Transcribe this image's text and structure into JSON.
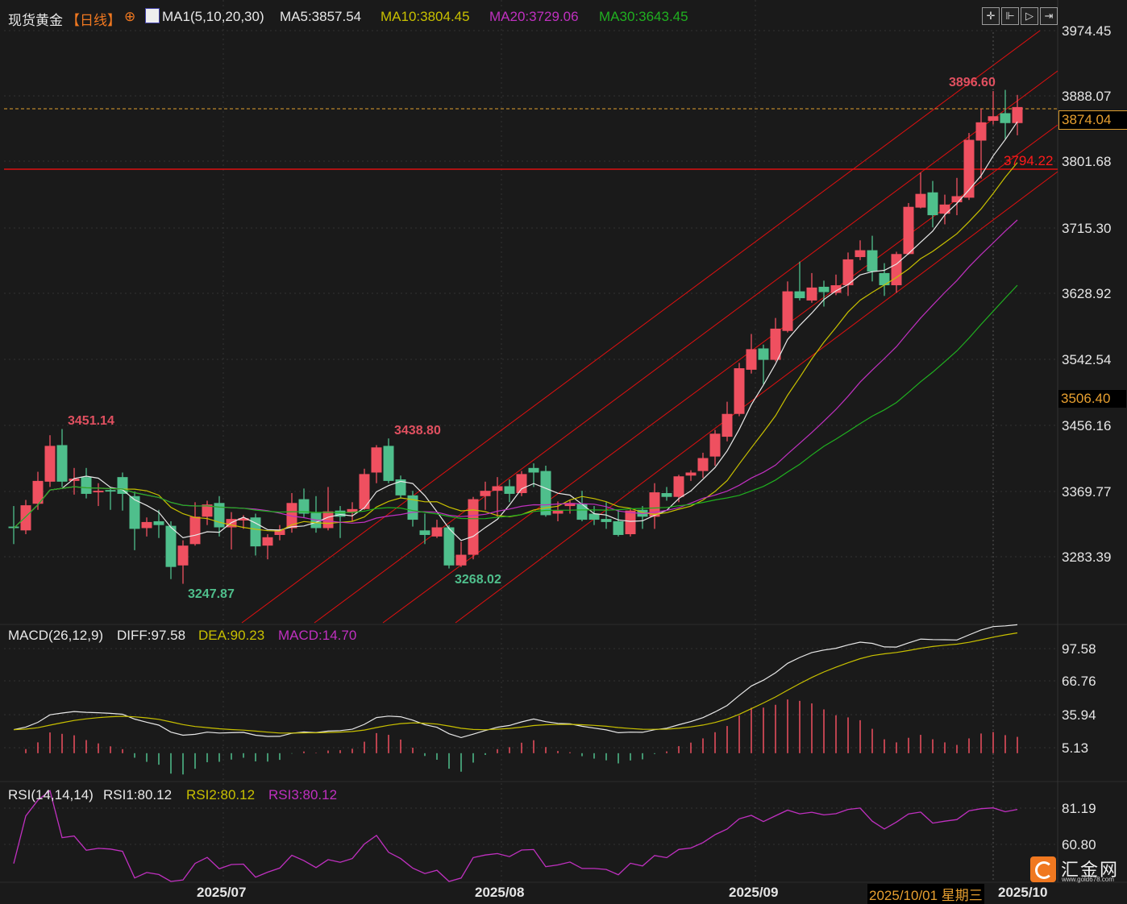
{
  "header": {
    "symbol": "现货黄金",
    "period": "【日线】",
    "ma_label": "MA1(5,10,20,30)",
    "ma5": "MA5:3857.54",
    "ma10": "MA10:3804.45",
    "ma20": "MA20:3729.06",
    "ma30": "MA30:3643.45"
  },
  "toolbar": {
    "icons": [
      "crosshair-icon",
      "range-icon",
      "play-icon",
      "scroll-right-icon"
    ]
  },
  "price_axis": {
    "ticks": [
      "3974.45",
      "3888.07",
      "3801.68",
      "3715.30",
      "3628.92",
      "3542.54",
      "3456.16",
      "3369.77",
      "3283.39"
    ],
    "current_price": "3874.04",
    "marker_price": "3506.40"
  },
  "annotations": {
    "high_recent": "3896.60",
    "high_july": "3451.14",
    "high_aug": "3438.80",
    "low_july": "3247.87",
    "low_aug": "3268.02",
    "hline": "3794.22"
  },
  "macd": {
    "label": "MACD(26,12,9)",
    "diff": "DIFF:97.58",
    "dea": "DEA:90.23",
    "macd": "MACD:14.70",
    "ticks": [
      "97.58",
      "66.76",
      "35.94",
      "5.13"
    ]
  },
  "rsi": {
    "label": "RSI(14,14,14)",
    "rsi1": "RSI1:80.12",
    "rsi2": "RSI2:80.12",
    "rsi3": "RSI3:80.12",
    "ticks": [
      "81.19",
      "60.80"
    ]
  },
  "dates": {
    "jul": "2025/07",
    "aug": "2025/08",
    "sep": "2025/09",
    "cursor": "2025/10/01 星期三",
    "oct": "2025/10"
  },
  "logo": {
    "name": "汇金网",
    "url": "www.gold678.com"
  },
  "colors": {
    "up": "#ef5060",
    "down": "#4fbf8c",
    "ma5": "#e8e8e8",
    "ma10": "#c8c000",
    "ma20": "#c030c0",
    "ma30": "#20b020",
    "channel": "#e01010"
  },
  "chart_data": {
    "type": "candlestick",
    "title": "现货黄金 日线",
    "ylim": [
      3283.39,
      3974.45
    ],
    "ohlc": [
      [
        3323,
        3350,
        3300,
        3321
      ],
      [
        3318,
        3358,
        3313,
        3351
      ],
      [
        3353,
        3395,
        3345,
        3383
      ],
      [
        3382,
        3443,
        3375,
        3429
      ],
      [
        3430,
        3451.14,
        3375,
        3382
      ],
      [
        3383,
        3400,
        3365,
        3386
      ],
      [
        3388,
        3400,
        3360,
        3366
      ],
      [
        3368,
        3380,
        3350,
        3370
      ],
      [
        3371,
        3375,
        3345,
        3369
      ],
      [
        3388,
        3394,
        3344,
        3366
      ],
      [
        3363,
        3369,
        3292,
        3320
      ],
      [
        3321,
        3335,
        3310,
        3329
      ],
      [
        3330,
        3345,
        3308,
        3325
      ],
      [
        3324,
        3330,
        3254,
        3270
      ],
      [
        3272,
        3305,
        3247.87,
        3298
      ],
      [
        3300,
        3355,
        3298,
        3336
      ],
      [
        3336,
        3357,
        3325,
        3352
      ],
      [
        3354,
        3363,
        3310,
        3322
      ],
      [
        3322,
        3342,
        3293,
        3333
      ],
      [
        3331,
        3338,
        3320,
        3334
      ],
      [
        3335,
        3340,
        3285,
        3297
      ],
      [
        3298,
        3313,
        3280,
        3309
      ],
      [
        3312,
        3325,
        3305,
        3319
      ],
      [
        3321,
        3367,
        3315,
        3354
      ],
      [
        3359,
        3373,
        3335,
        3340
      ],
      [
        3341,
        3363,
        3315,
        3321
      ],
      [
        3321,
        3375,
        3318,
        3343
      ],
      [
        3344,
        3350,
        3308,
        3336
      ],
      [
        3341,
        3355,
        3330,
        3346
      ],
      [
        3346,
        3399,
        3345,
        3392
      ],
      [
        3394,
        3430,
        3380,
        3427
      ],
      [
        3429,
        3438.8,
        3380,
        3383
      ],
      [
        3385,
        3390,
        3360,
        3364
      ],
      [
        3364,
        3370,
        3323,
        3332
      ],
      [
        3318,
        3340,
        3300,
        3312
      ],
      [
        3310,
        3332,
        3308,
        3322
      ],
      [
        3322,
        3325,
        3268.02,
        3272
      ],
      [
        3272,
        3303,
        3270,
        3286
      ],
      [
        3286,
        3362,
        3280,
        3359
      ],
      [
        3363,
        3382,
        3345,
        3370
      ],
      [
        3370,
        3388,
        3335,
        3376
      ],
      [
        3376,
        3385,
        3355,
        3366
      ],
      [
        3367,
        3396,
        3363,
        3392
      ],
      [
        3400,
        3406,
        3375,
        3394
      ],
      [
        3396,
        3403,
        3336,
        3338
      ],
      [
        3340,
        3356,
        3330,
        3344
      ],
      [
        3350,
        3358,
        3340,
        3354
      ],
      [
        3353,
        3370,
        3330,
        3332
      ],
      [
        3340,
        3350,
        3325,
        3332
      ],
      [
        3333,
        3355,
        3320,
        3329
      ],
      [
        3330,
        3345,
        3310,
        3312
      ],
      [
        3313,
        3346,
        3310,
        3344
      ],
      [
        3345,
        3350,
        3320,
        3336
      ],
      [
        3336,
        3380,
        3320,
        3368
      ],
      [
        3367,
        3375,
        3357,
        3362
      ],
      [
        3362,
        3391,
        3355,
        3389
      ],
      [
        3390,
        3397,
        3383,
        3394
      ],
      [
        3396,
        3420,
        3387,
        3413
      ],
      [
        3415,
        3450,
        3403,
        3445
      ],
      [
        3441,
        3487,
        3435,
        3471
      ],
      [
        3471,
        3538,
        3468,
        3531
      ],
      [
        3529,
        3576,
        3524,
        3556
      ],
      [
        3557,
        3562,
        3510,
        3542
      ],
      [
        3542,
        3597,
        3540,
        3583
      ],
      [
        3580,
        3645,
        3578,
        3632
      ],
      [
        3632,
        3671,
        3620,
        3623
      ],
      [
        3620,
        3656,
        3617,
        3637
      ],
      [
        3638,
        3646,
        3612,
        3631
      ],
      [
        3630,
        3654,
        3627,
        3640
      ],
      [
        3640,
        3683,
        3626,
        3674
      ],
      [
        3677,
        3699,
        3673,
        3686
      ],
      [
        3686,
        3705,
        3645,
        3658
      ],
      [
        3656,
        3669,
        3626,
        3640
      ],
      [
        3640,
        3684,
        3630,
        3681
      ],
      [
        3681,
        3748,
        3680,
        3743
      ],
      [
        3742,
        3788,
        3741,
        3760
      ],
      [
        3762,
        3777,
        3716,
        3732
      ],
      [
        3734,
        3759,
        3720,
        3746
      ],
      [
        3749,
        3781,
        3732,
        3757
      ],
      [
        3755,
        3840,
        3752,
        3831
      ],
      [
        3830,
        3872,
        3780,
        3854
      ],
      [
        3856,
        3895,
        3851,
        3862
      ],
      [
        3866,
        3896.6,
        3832,
        3853
      ],
      [
        3853,
        3890,
        3837,
        3874.04
      ]
    ],
    "ma_periods": [
      5,
      10,
      20,
      30
    ],
    "horizontal_line": 3794.22,
    "macd_params": [
      12,
      26,
      9
    ],
    "macd_ylim": [
      5.13,
      97.58
    ],
    "rsi_period": 14,
    "rsi_ylim": [
      60.8,
      81.19
    ],
    "x_labels": [
      "2025/07",
      "2025/08",
      "2025/09",
      "2025/10"
    ]
  }
}
